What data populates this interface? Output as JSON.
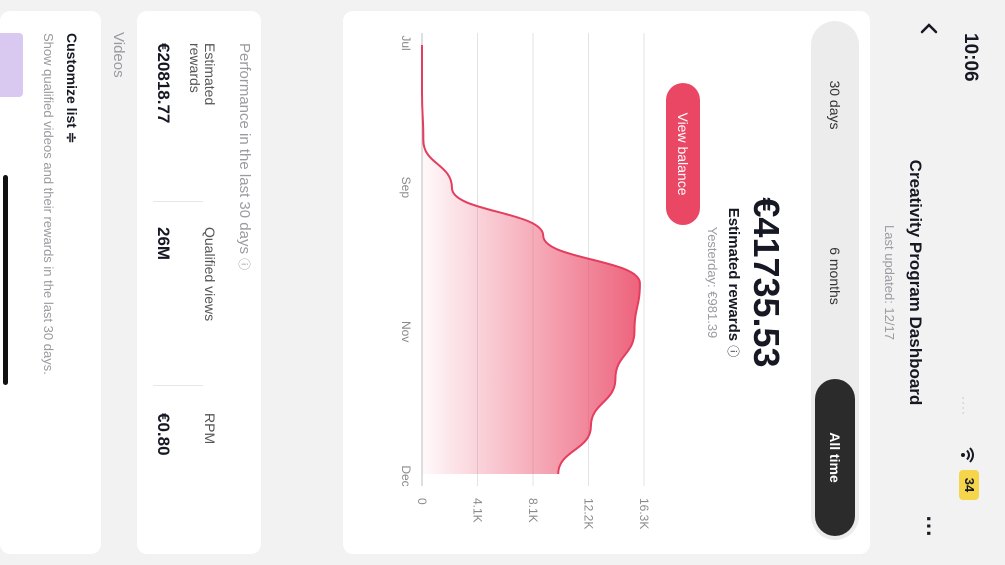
{
  "status_bar": {
    "time": "10:06",
    "battery": "34"
  },
  "header": {
    "title": "Creativity Program Dashboard",
    "last_updated": "Last updated: 12/17"
  },
  "period_tabs": [
    "30 days",
    "6 months",
    "All time"
  ],
  "selected_tab": "All time",
  "summary": {
    "amount": "€41735.53",
    "label": "Estimated rewards",
    "yesterday": "Yesterday: €981.39",
    "view_balance": "View balance"
  },
  "colors": {
    "accent": "#ea4765",
    "tab_active": "#2b2b2b"
  },
  "chart_data": {
    "type": "area",
    "x_tick_labels": [
      "Jul",
      "Sep",
      "Nov",
      "Dec"
    ],
    "y_tick_labels": [
      "16.3K",
      "12.2K",
      "8.1K",
      "4.1K",
      "0"
    ],
    "ylim": [
      0,
      16300
    ],
    "x": [
      "Jul",
      "Aug",
      "Sep",
      "Sep",
      "Oct",
      "Oct",
      "Nov",
      "Nov",
      "Dec",
      "Dec"
    ],
    "values": [
      0,
      0,
      100,
      2200,
      8900,
      16000,
      15600,
      14200,
      12400,
      10000
    ],
    "grid": true
  },
  "performance": {
    "heading": "Performance in the last 30 days",
    "metrics": [
      {
        "label_line1": "Estimated",
        "label_line2": "rewards",
        "value": "€20818.77"
      },
      {
        "label_line1": "Qualified views",
        "label_line2": "",
        "value": "26M"
      },
      {
        "label_line1": "RPM",
        "label_line2": "",
        "value": "€0.80"
      }
    ]
  },
  "videos": {
    "heading": "Videos",
    "customize": "Customize list",
    "description": "Show qualified videos and their rewards in the last 30 days."
  }
}
